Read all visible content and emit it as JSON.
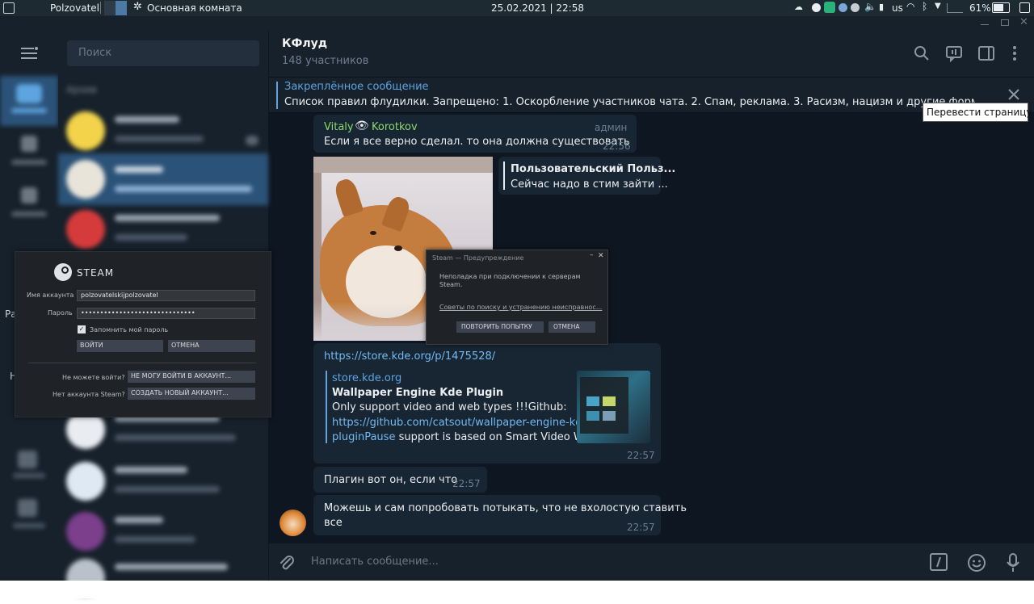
{
  "system_panel": {
    "user": "Polzovatel",
    "room": "Основная комната",
    "datetime": "25.02.2021 | 22:58",
    "kb_layout": "us",
    "battery": "61%"
  },
  "sidebar": {
    "search_placeholder": "Поиск",
    "archive_label": "Архив",
    "side_letter_1": "Ра",
    "side_letter_2": "Н"
  },
  "chat": {
    "title": "КФлуд",
    "subtitle": "148 участников"
  },
  "pinned": {
    "title": "Закреплённое сообщение",
    "text": "Список правил флудилки.  Запрещено: 1. Оскорбление участников чата. 2. Спам, реклама. 3. Расизм, нацизм и другие формы дискриминац"
  },
  "tooltip": "Перевести страницу",
  "messages": {
    "m1": {
      "author_first": "Vitaly",
      "author_emoji": "👁",
      "author_last": "Korotkov",
      "role": "админ",
      "text": "Если я все верно сделал. то она должна существовать",
      "time": "22:56"
    },
    "reply": {
      "name": "Пользовательский Польз...",
      "text": "Сейчас надо в стим зайти ..."
    },
    "m2": {
      "url": "https://store.kde.org/p/1475528/",
      "site": "store.kde.org",
      "preview_title": "Wallpaper Engine Kde Plugin",
      "desc_1": "Only support video and web types !!!Github:",
      "desc_link_1": "https://github.com/catsout/wallpaper-engine-kde-",
      "desc_link_2": "pluginPause",
      "desc_tail": " support is based on Smart Video W...",
      "time": "22:57"
    },
    "m3": {
      "text": "Плагин вот он, если что",
      "time": "22:57"
    },
    "m4": {
      "text_1": "Можешь и сам попробовать потыкать, что не вхолостую ставить",
      "text_2": "все",
      "time": "22:57"
    }
  },
  "composer": {
    "placeholder": "Написать сообщение..."
  },
  "steam_login": {
    "logo": "STEAM",
    "account_label": "Имя аккаунта",
    "account_value": "polzovatelskijpolzovatel",
    "password_label": "Пароль",
    "password_value": "••••••••••••••••••••••••••••••",
    "remember_label": "Запомнить мой пароль",
    "login_button": "ВОЙТИ",
    "cancel_button": "ОТМЕНА",
    "cant_login_label": "Не можете войти?",
    "cant_login_button": "НЕ МОГУ ВОЙТИ В АККАУНТ...",
    "no_account_label": "Нет аккаунта Steam?",
    "create_button": "СОЗДАТЬ НОВЫЙ АККАУНТ..."
  },
  "steam_warning": {
    "title": "Steam — Предупреждение",
    "text_1": "Неполадка при подключении к серверам",
    "text_2": "Steam.",
    "link": "Советы по поиску и устранению неисправнос...",
    "retry_button": "ПОВТОРИТЬ ПОПЫТКУ",
    "cancel_button": "ОТМЕНА"
  },
  "colors": {
    "accent": "#5ea4e0",
    "author": "#8bd96c",
    "bubble": "#182533",
    "bg": "#0e1621"
  }
}
